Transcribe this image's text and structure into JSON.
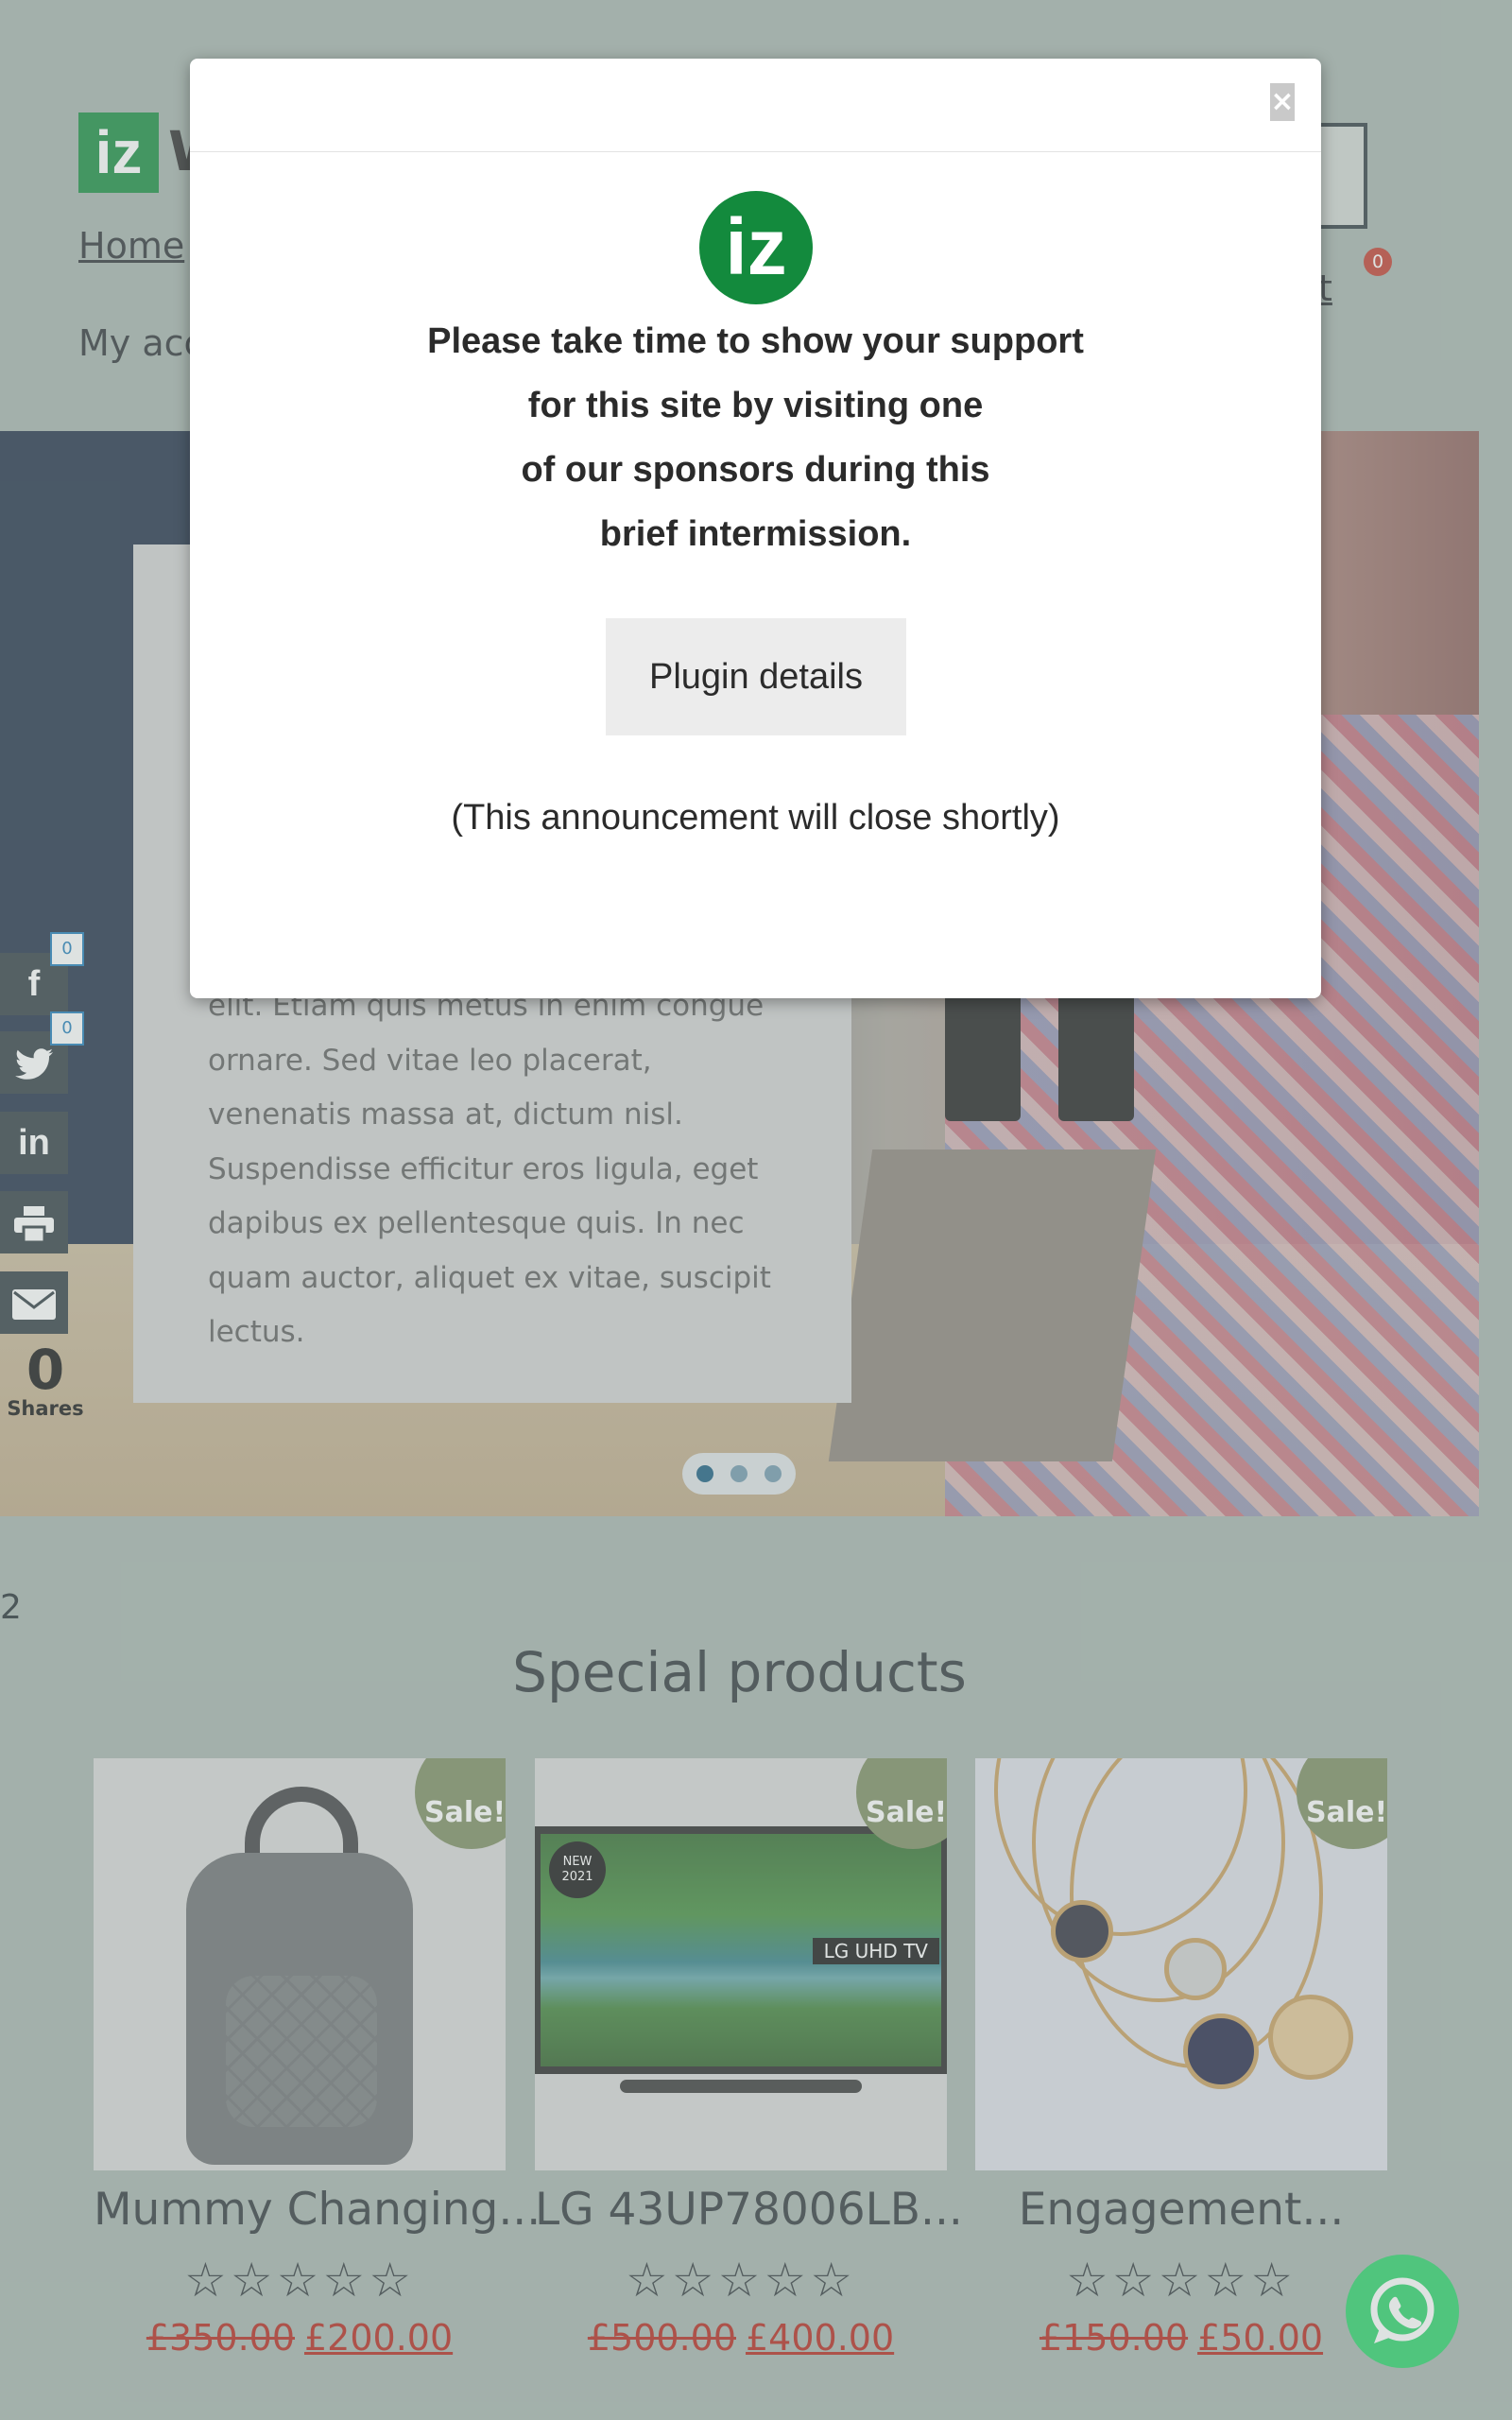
{
  "header": {
    "logo_text": "iz",
    "logo_word_visible": "W",
    "nav_home": "Home",
    "nav_wishlist": "hlist",
    "wishlist_count": "0",
    "my_account": "My acc"
  },
  "hero": {
    "body_text": "elit. Etiam quis metus in enim congue ornare. Sed vitae leo placerat, venenatis massa at, dictum nisl. Suspendisse efficitur eros ligula, eget dapibus ex pellentesque quis. In nec quam auctor, aliquet ex vitae, suscipit lectus.",
    "slides": 3,
    "active_slide": 1
  },
  "share": {
    "facebook_count": "0",
    "twitter_count": "0",
    "total": "0",
    "label": "Shares",
    "icons": [
      "facebook-icon",
      "twitter-icon",
      "linkedin-icon",
      "print-icon",
      "email-icon"
    ]
  },
  "stray_text": "2",
  "section_title": "Special products",
  "products": [
    {
      "name": "Mummy Changing...",
      "badge": "Sale!",
      "old_price": "£350.00",
      "new_price": "£200.00",
      "rating": 0
    },
    {
      "name": "LG 43UP78006LB...",
      "badge": "Sale!",
      "old_price": "£500.00",
      "new_price": "£400.00",
      "rating": 0,
      "tv_badge": "NEW 2021",
      "tv_label": "LG UHD TV"
    },
    {
      "name": "Engagement...",
      "badge": "Sale!",
      "old_price": "£150.00",
      "new_price": "£50.00",
      "rating": 0
    }
  ],
  "modal": {
    "logo_text": "iz",
    "close_label": "×",
    "message_lines": [
      "Please take time to show your support",
      "for this site by visiting one",
      "of our sponsors during this",
      "brief intermission."
    ],
    "button_label": "Plugin details",
    "note": "(This announcement will close shortly)"
  },
  "colors": {
    "page_bg": "#a5b3ad",
    "brand_green": "#138a3d",
    "sale_badge": "#7a8a5e",
    "price_red": "#b42318",
    "whatsapp": "#25d366"
  }
}
